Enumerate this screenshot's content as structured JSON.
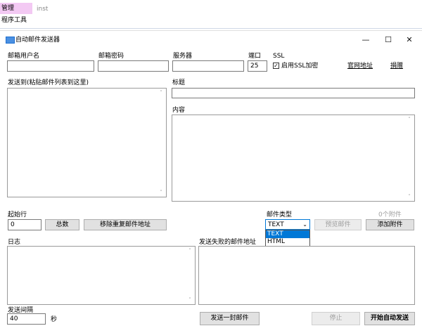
{
  "background_app": {
    "tab_manage": "管理",
    "tools": "程序工具",
    "inst": "inst"
  },
  "window": {
    "title": "自动邮件发送器",
    "title_icon": "mail-icon",
    "controls": {
      "minimize": "—",
      "maximize": "☐",
      "close": "✕"
    }
  },
  "account": {
    "user_label": "邮箱用户名",
    "user_value": "",
    "password_label": "邮箱密码",
    "password_value": "",
    "server_label": "服务器",
    "server_value": "",
    "port_label": "端口",
    "port_value": "25",
    "ssl_label": "SSL",
    "ssl_checkbox_label": "启用SSL加密",
    "ssl_checked": true,
    "official_link": "官网地址",
    "donate_link": "捐赠"
  },
  "recipients": {
    "label": "发送到(粘贴邮件列表到这里)",
    "value": ""
  },
  "subject": {
    "label": "标题",
    "value": ""
  },
  "content": {
    "label": "内容",
    "value": ""
  },
  "controls": {
    "start_row_label": "起始行",
    "start_row_value": "0",
    "total_button": "总数",
    "dedupe_button": "移除重复邮件地址",
    "mail_type_label": "邮件类型",
    "mail_type_value": "TEXT",
    "mail_type_options": [
      "TEXT",
      "HTML"
    ],
    "preview_button": "预览邮件",
    "attachment_count": "0个附件",
    "add_attachment_button": "添加附件"
  },
  "log": {
    "label": "日志",
    "value": ""
  },
  "failed": {
    "label": "发送失败的邮件地址",
    "value": ""
  },
  "footer": {
    "interval_label": "发送间隔",
    "interval_value": "40",
    "interval_unit": "秒",
    "send_one_button": "发送一封邮件",
    "stop_button": "停止",
    "start_auto_button": "开始自动发送"
  },
  "colors": {
    "accent": "#0078d7",
    "highlight_tab": "#f3c9f3"
  }
}
